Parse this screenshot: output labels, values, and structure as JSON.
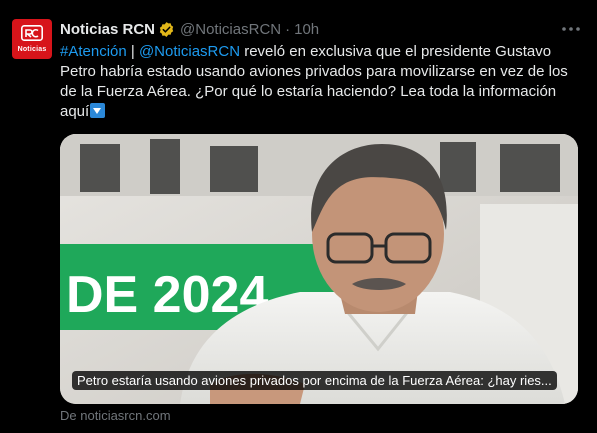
{
  "account": {
    "display_name": "Noticias RCN",
    "handle": "@NoticiasRCN",
    "separator": "·",
    "time": "10h",
    "avatar_text": "Noticias",
    "verified_icon": "gold-verified-badge-icon"
  },
  "tweet": {
    "hashtag": "#Atención",
    "divider": " | ",
    "mention": "@NoticiasRCN",
    "body": " reveló en exclusiva que el presidente Gustavo Petro habría estado usando aviones privados para movilizarse en vez de los de la Fuerza Aérea. ¿Por qué lo estaría haciendo? Lea toda la información aquí",
    "emoji": "down-arrow-button-emoji"
  },
  "card": {
    "background_text": "DE 2024",
    "caption": "Petro estaría usando aviones privados por encima de la Fuerza Aérea: ¿hay ries...",
    "source": "De noticiasrcn.com"
  },
  "colors": {
    "background": "#000000",
    "text": "#e7e9ea",
    "secondary": "#71767b",
    "link": "#1d9bf0",
    "brand_red": "#d7141a",
    "badge_gold": "#e2b719",
    "banner_green": "#1fa85a"
  }
}
